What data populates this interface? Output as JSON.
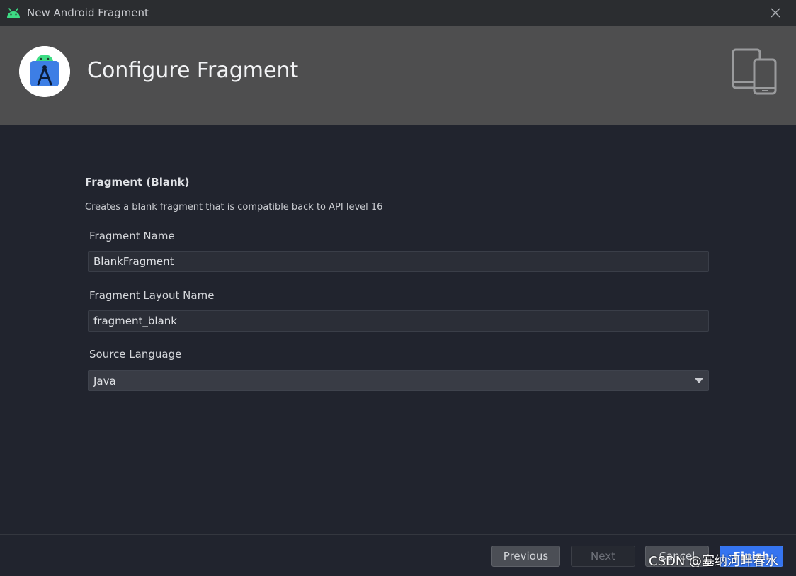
{
  "window": {
    "title": "New Android Fragment"
  },
  "header": {
    "title": "Configure Fragment"
  },
  "template": {
    "name": "Fragment (Blank)",
    "description": "Creates a blank fragment that is compatible back to API level 16"
  },
  "form": {
    "fragment_name": {
      "label": "Fragment Name",
      "value": "BlankFragment"
    },
    "layout_name": {
      "label": "Fragment Layout Name",
      "value": "fragment_blank"
    },
    "source_language": {
      "label": "Source Language",
      "value": "Java"
    }
  },
  "buttons": {
    "previous": "Previous",
    "next": "Next",
    "cancel": "Cancel",
    "finish": "Finish"
  },
  "watermark": "CSDN @塞纳河畔春水",
  "colors": {
    "background": "#21242e",
    "header_band": "#4e4e4f",
    "accent": "#3574f0",
    "android_green": "#3ddc84"
  },
  "icons": [
    "android-icon",
    "close-icon",
    "android-studio-logo",
    "devices-icon",
    "chevron-down-icon"
  ]
}
